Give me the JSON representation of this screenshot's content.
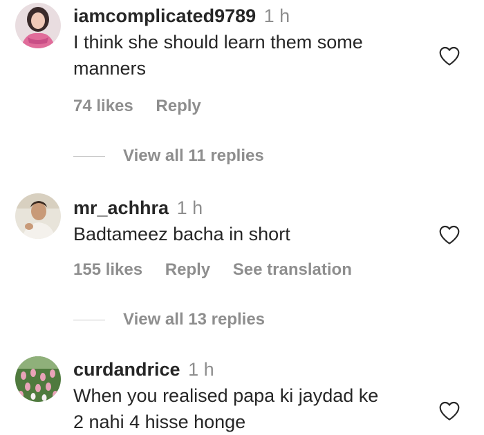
{
  "comments": [
    {
      "username": "iamcomplicated9789",
      "time": "1 h",
      "text_line1": "I think she should learn them some",
      "text_line2": "manners",
      "likes": "74 likes",
      "reply": "Reply",
      "view_replies": "View all 11 replies"
    },
    {
      "username": "mr_achhra",
      "time": "1 h",
      "text_line1": "Badtameez bacha in short",
      "likes": "155 likes",
      "reply": "Reply",
      "see_translation": "See translation",
      "view_replies": "View all 13 replies"
    },
    {
      "username": "curdandrice",
      "time": "1 h",
      "text_line1": "When you realised papa ki jaydad ke",
      "text_line2": "2 nahi 4 hisse honge"
    }
  ],
  "icons": {
    "like": "heart-outline-icon"
  },
  "colors": {
    "primary_text": "#262626",
    "secondary_text": "#8e8e8e",
    "divider": "#c7c7c7"
  }
}
